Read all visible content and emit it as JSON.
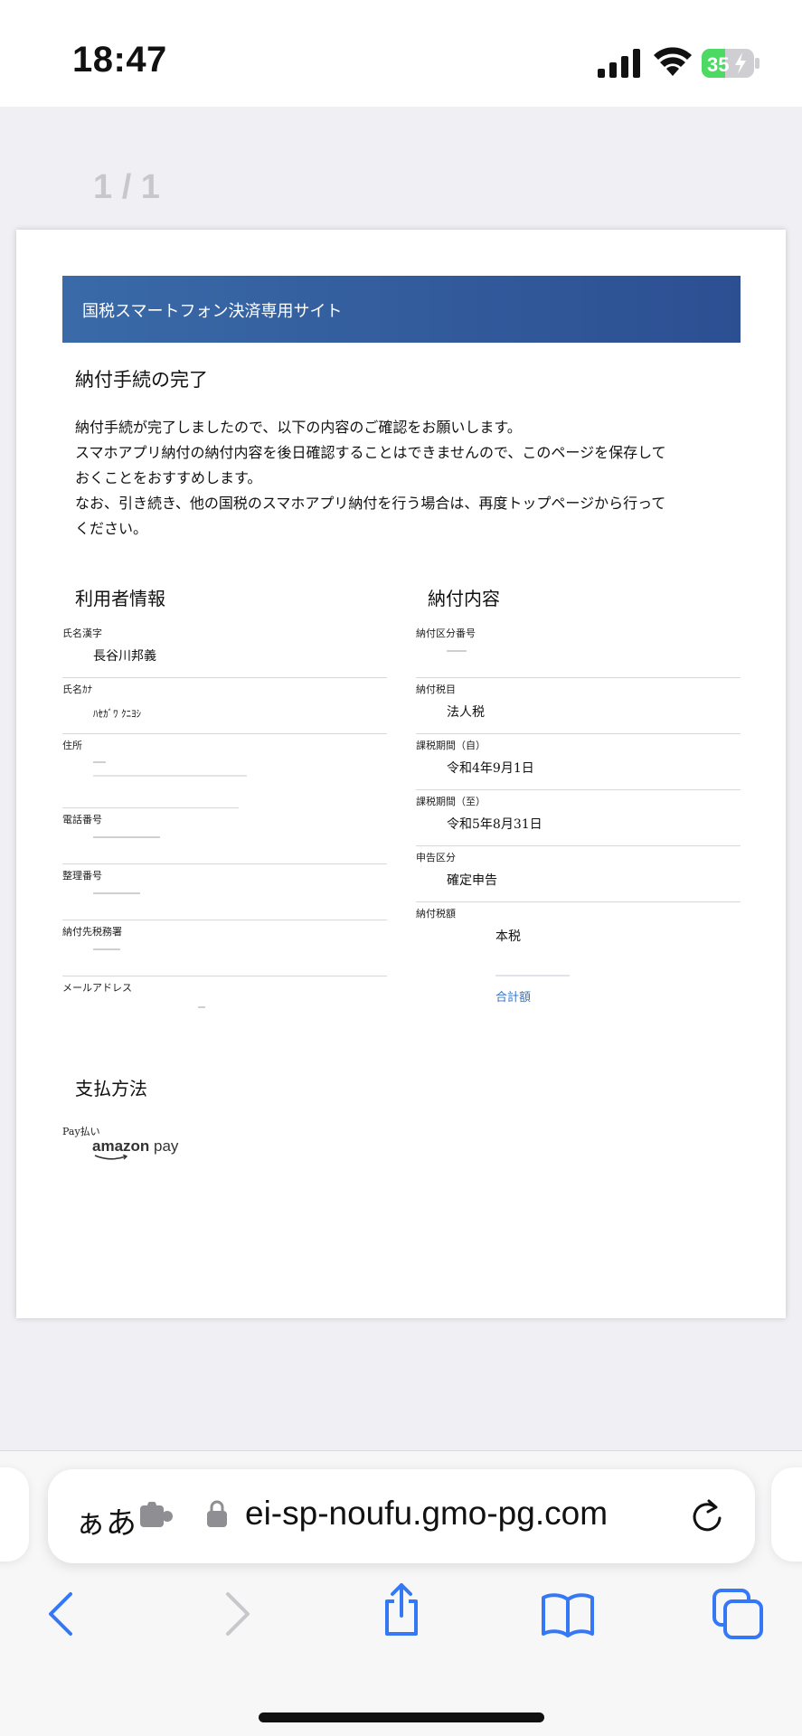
{
  "status_bar": {
    "time": "18:47",
    "battery": "35"
  },
  "viewer": {
    "page_indicator": "1 / 1"
  },
  "document": {
    "banner_title": "国税スマートフォン決済専用サイト",
    "heading": "納付手続の完了",
    "intro_lines": [
      "納付手続が完了しましたので、以下の内容のご確認をお願いします。",
      "スマホアプリ納付の納付内容を後日確認することはできませんので、このページを保存して",
      "おくことをおすすめします。",
      "なお、引き続き、他の国税のスマホアプリ納付を行う場合は、再度トップページから行って",
      "ください。"
    ],
    "user_info": {
      "title": "利用者情報",
      "fields": [
        {
          "label": "氏名漢字",
          "value": "長谷川邦義"
        },
        {
          "label": "氏名ｶﾅ",
          "value": "ﾊｾｶﾞﾜ ｸﾆﾖｼ"
        },
        {
          "label": "住所",
          "value": ""
        },
        {
          "label": "電話番号",
          "value": ""
        },
        {
          "label": "整理番号",
          "value": ""
        },
        {
          "label": "納付先税務署",
          "value": ""
        },
        {
          "label": "メールアドレス",
          "value": ""
        }
      ]
    },
    "payment_content": {
      "title": "納付内容",
      "fields": [
        {
          "label": "納付区分番号",
          "value": ""
        },
        {
          "label": "納付税目",
          "value": "法人税"
        },
        {
          "label": "課税期間（自）",
          "value": "令和4年9月1日"
        },
        {
          "label": "課税期間（至）",
          "value": "令和5年8月31日"
        },
        {
          "label": "申告区分",
          "value": "確定申告"
        },
        {
          "label": "納付税額",
          "value": ""
        }
      ],
      "sub_item": "本税",
      "total_label": "合計額"
    },
    "payment_method": {
      "title": "支払方法",
      "label": "Pay払い",
      "logo_text_1": "amazon",
      "logo_text_2": " pay"
    }
  },
  "browser": {
    "aa_label": "ぁあ",
    "url": "ei-sp-noufu.gmo-pg.com"
  },
  "colors": {
    "banner": "#2c4f92",
    "accent": "#3a74c4"
  }
}
